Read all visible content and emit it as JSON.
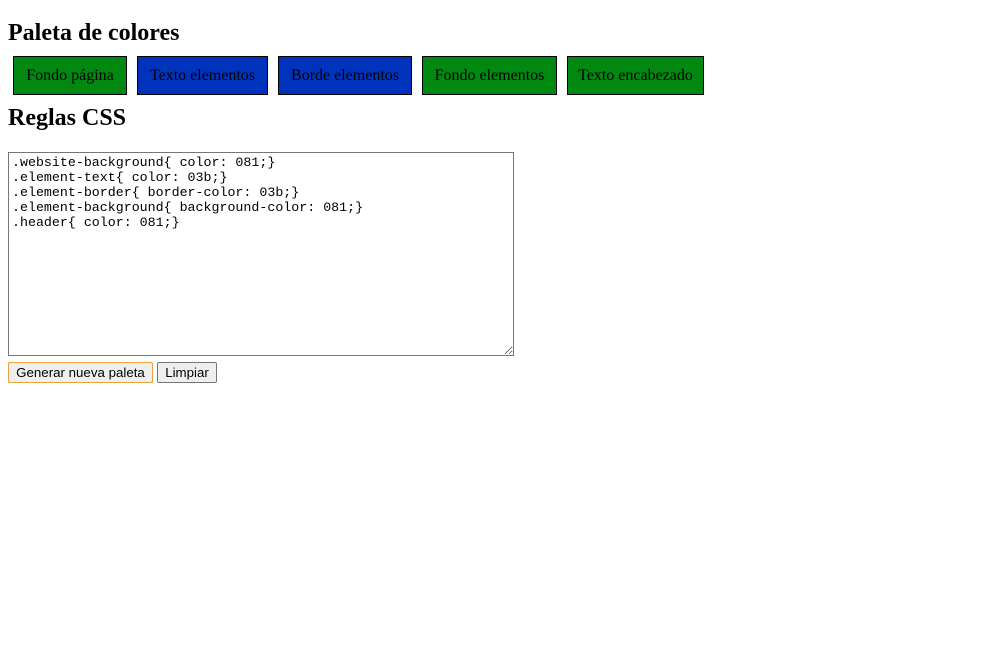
{
  "palette_section": {
    "title": "Paleta de colores",
    "swatches": [
      {
        "label": "Fondo página",
        "color": "#008811"
      },
      {
        "label": "Texto elementos",
        "color": "#0033bb"
      },
      {
        "label": "Borde elementos",
        "color": "#0033bb"
      },
      {
        "label": "Fondo elementos",
        "color": "#008811"
      },
      {
        "label": "Texto encabezado",
        "color": "#008811"
      }
    ]
  },
  "rules_section": {
    "title": "Reglas CSS",
    "css_text": ".website-background{ color: 081;}\n.element-text{ color: 03b;}\n.element-border{ border-color: 03b;}\n.element-background{ background-color: 081;}\n.header{ color: 081;}"
  },
  "buttons": {
    "generate_label": "Generar nueva paleta",
    "clear_label": "Limpiar"
  }
}
